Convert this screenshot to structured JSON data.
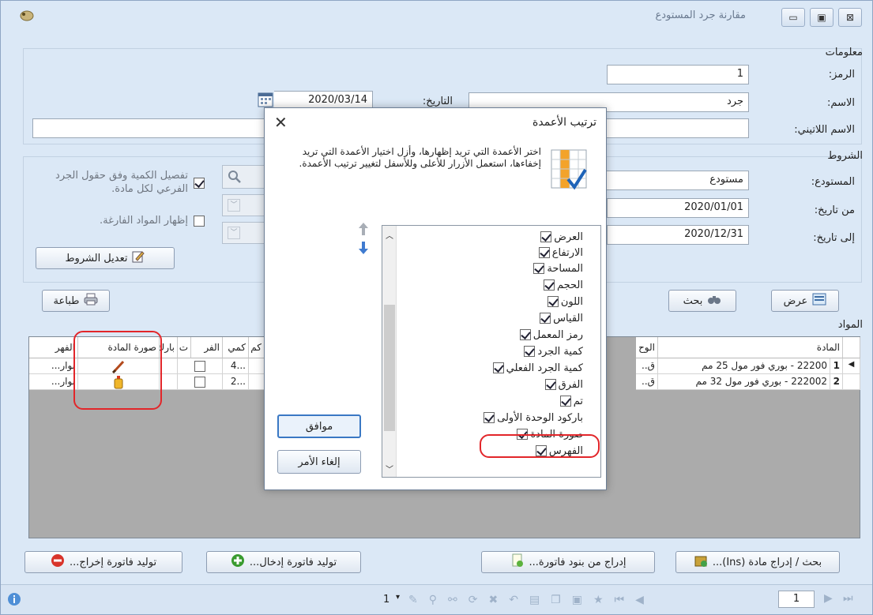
{
  "window": {
    "title": "مقارنة جرد المستودع",
    "controls": {
      "minimize": "▭",
      "restore": "▣",
      "close": "⊠"
    }
  },
  "info": {
    "section": "معلومات",
    "code_label": "الرمز:",
    "code_value": "1",
    "name_label": "الاسم:",
    "name_value": "جرد",
    "date_label": "التاريخ:",
    "date_value": "2020/03/14",
    "latin_label": "الاسم اللاتيني:",
    "latin_value": ""
  },
  "conditions": {
    "section": "الشروط",
    "warehouse_label": "المستودع:",
    "warehouse_value": "مستودع",
    "from_label": "من تاريخ:",
    "from_value": "2020/01/01",
    "to_label": "إلى تاريخ:",
    "to_value": "2020/12/31",
    "option_detail": "تفصيل الكمية وفق حقول الجرد الفرعي لكل مادة.",
    "option_empty": "إظهار المواد الفارغة.",
    "edit_button": "تعديل الشروط"
  },
  "actions": {
    "print": "طباعة",
    "search": "بحث",
    "display": "عرض"
  },
  "materials": {
    "section": "المواد",
    "columns": [
      "المادة",
      "الوح",
      "كم",
      "كمي",
      "الفر",
      "ت",
      "بارك",
      "صورة المادة",
      "الفهر"
    ],
    "rows": [
      {
        "marker": "◀",
        "num": "1",
        "material": "22200 - بوري فور مول 25 مم",
        "unit": "ق..",
        "qty": "...4",
        "checked": false,
        "image": "brush",
        "index": "بوار..."
      },
      {
        "marker": "",
        "num": "2",
        "material": "222002 - بوري فور مول 32 مم",
        "unit": "ق..",
        "qty": "...2",
        "checked": false,
        "image": "bottle",
        "index": "بوار..."
      }
    ]
  },
  "bottom_buttons": {
    "search_insert": "بحث / إدراج مادة (Ins)...",
    "insert_from_invoice": "إدراج من بنود فاتورة...",
    "generate_in": "توليد فاتورة إدخال...",
    "generate_out": "توليد فاتورة إخراج..."
  },
  "statusbar": {
    "left_num": "1",
    "page": "1"
  },
  "dialog": {
    "title": "ترتيب الأعمدة",
    "close": "✕",
    "description": "اختر الأعمدة التي تريد إظهارها، وأزل اختيار الأعمدة التي تريد إخفاءها، استعمل الأزرار للأعلى وللأسفل لتغيير ترتيب الأعمدة.",
    "ok": "موافق",
    "cancel": "إلغاء الأمر",
    "items": [
      {
        "label": "العرض",
        "checked": true
      },
      {
        "label": "الارتفاع",
        "checked": true
      },
      {
        "label": "المساحة",
        "checked": true
      },
      {
        "label": "الحجم",
        "checked": true
      },
      {
        "label": "اللون",
        "checked": true
      },
      {
        "label": "القياس",
        "checked": true
      },
      {
        "label": "رمز المعمل",
        "checked": true
      },
      {
        "label": "كمية الجرد",
        "checked": true
      },
      {
        "label": "كمية الجرد الفعلي",
        "checked": true
      },
      {
        "label": "الفرق",
        "checked": true
      },
      {
        "label": "تم",
        "checked": true
      },
      {
        "label": "باركود الوحدة الأولى",
        "checked": true
      },
      {
        "label": "صورة المادة",
        "checked": true
      },
      {
        "label": "الفهرس",
        "checked": true
      }
    ]
  }
}
